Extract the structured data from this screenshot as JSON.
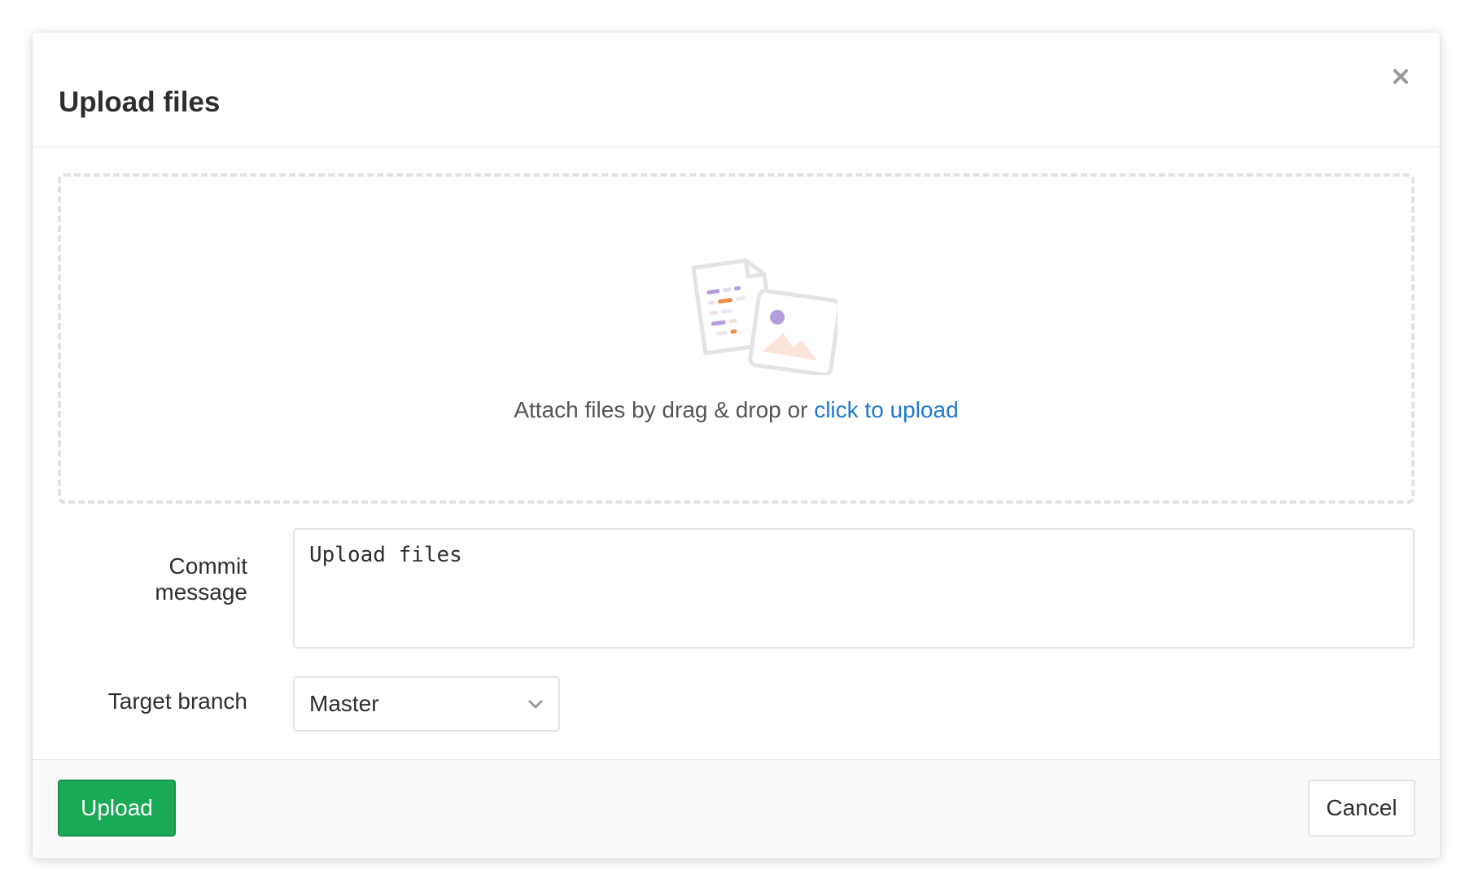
{
  "modal": {
    "title": "Upload files",
    "close_icon": "close-icon"
  },
  "dropzone": {
    "illustration_icon": "files-illustration",
    "text": "Attach files by drag & drop or ",
    "link": "click to upload"
  },
  "form": {
    "commit_label": "Commit message",
    "commit_value": "Upload files",
    "branch_label": "Target branch",
    "branch_value": "Master",
    "branch_icon": "chevron-down-icon"
  },
  "footer": {
    "upload_label": "Upload",
    "cancel_label": "Cancel"
  },
  "colors": {
    "primary_green": "#1aaa55",
    "link_blue": "#1f78d1",
    "border_gray": "#e5e5e5"
  }
}
